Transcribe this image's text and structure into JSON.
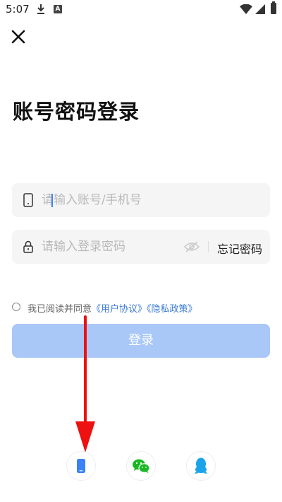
{
  "status_bar": {
    "time": "5:07"
  },
  "page": {
    "title": "账号密码登录"
  },
  "account_field": {
    "placeholder": "请输入账号/手机号",
    "value": ""
  },
  "password_field": {
    "placeholder": "请输入登录密码",
    "value": "",
    "forgot_label": "忘记密码"
  },
  "agreement": {
    "prefix": "我已阅读并同意",
    "user_agreement": "《用户协议》",
    "privacy_policy": "《隐私政策》",
    "checked": false
  },
  "login_button": {
    "label": "登录"
  },
  "social_logins": [
    {
      "name": "phone-login",
      "icon": "phone-icon"
    },
    {
      "name": "wechat-login",
      "icon": "wechat-icon"
    },
    {
      "name": "qq-login",
      "icon": "qq-icon"
    }
  ],
  "colors": {
    "accent": "#3a7bd5",
    "login_button_disabled": "#aac8f7",
    "arrow": "#e11",
    "wechat": "#1ab825",
    "qq": "#1aa3e8",
    "phone": "#3b82f6"
  }
}
